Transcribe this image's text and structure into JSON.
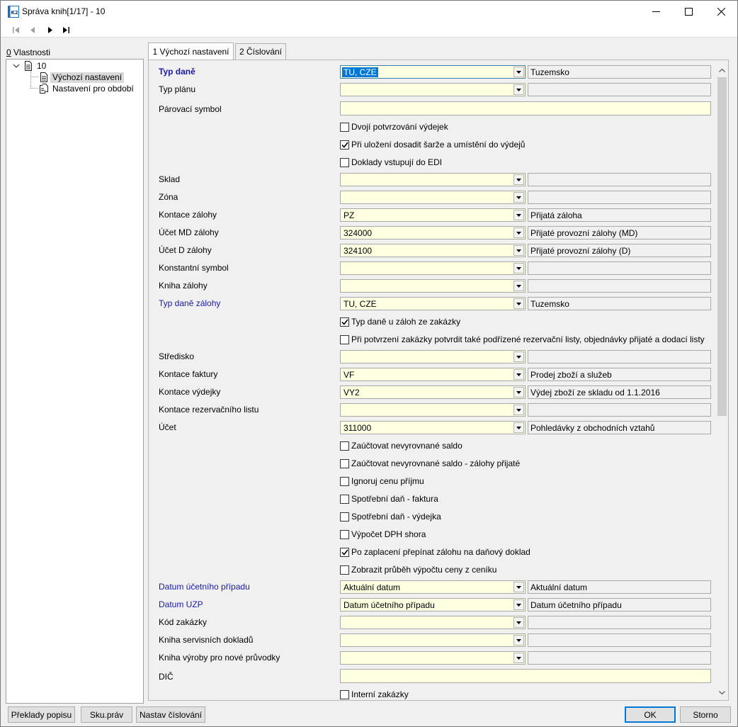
{
  "window": {
    "title": "Správa knih[1/17] - 10",
    "icon": "k2-app-icon"
  },
  "nav": {
    "buttons": [
      "first-record-icon",
      "previous-record-icon",
      "next-record-icon",
      "last-record-icon"
    ]
  },
  "left": {
    "label_hotkey": "0",
    "label_rest": " Vlastnosti",
    "tree": {
      "root": "10",
      "children": [
        "Výchozí nastavení",
        "Nastavení pro období"
      ]
    }
  },
  "tabs": [
    {
      "label": "1 Výchozí nastavení",
      "active": true
    },
    {
      "label": "2 Číslování",
      "active": false
    }
  ],
  "form": {
    "typ_dane": {
      "label": "Typ daně",
      "value": "TU, CZE",
      "desc": "Tuzemsko"
    },
    "typ_planu": {
      "label": "Typ plánu",
      "value": "",
      "desc": ""
    },
    "parovaci_symbol": {
      "label": "Párovací symbol",
      "value": ""
    },
    "dvoji_potvrzovani": {
      "label": "Dvojí potvrzování výdejek",
      "checked": false
    },
    "pri_ulozeni": {
      "label": "Při uložení dosadit šarže a umístění do výdejů",
      "checked": true
    },
    "doklady_edi": {
      "label": "Doklady vstupují do EDI",
      "checked": false
    },
    "sklad": {
      "label": "Sklad",
      "value": "",
      "desc": ""
    },
    "zona": {
      "label": "Zóna",
      "value": "",
      "desc": ""
    },
    "kontace_zalohy": {
      "label": "Kontace zálohy",
      "value": "PZ",
      "desc": "Přijatá záloha"
    },
    "ucet_md_zalohy": {
      "label": "Účet MD zálohy",
      "value": "324000",
      "desc": "Přijaté provozní zálohy (MD)"
    },
    "ucet_d_zalohy": {
      "label": "Účet D zálohy",
      "value": "324100",
      "desc": "Přijaté provozní zálohy (D)"
    },
    "konstantni_symbol": {
      "label": "Konstantní symbol",
      "value": "",
      "desc": ""
    },
    "kniha_zalohy": {
      "label": "Kniha zálohy",
      "value": "",
      "desc": ""
    },
    "typ_dane_zalohy": {
      "label": "Typ daně zálohy",
      "value": "TU, CZE",
      "desc": "Tuzemsko"
    },
    "typ_dane_u_zaloh": {
      "label": "Typ daně u záloh ze zakázky",
      "checked": true
    },
    "pri_potvrzeni": {
      "label": "Při potvrzení zakázky potvrdit také podřízené rezervační listy, objednávky přijaté a dodací listy",
      "checked": false
    },
    "stredisko": {
      "label": "Středisko",
      "value": "",
      "desc": ""
    },
    "kontace_faktury": {
      "label": "Kontace faktury",
      "value": "VF",
      "desc": "Prodej zboží a služeb"
    },
    "kontace_vydejky": {
      "label": "Kontace výdejky",
      "value": "VY2",
      "desc": "Výdej zboží ze skladu od 1.1.2016"
    },
    "kontace_rezervacniho": {
      "label": "Kontace rezervačního listu",
      "value": "",
      "desc": ""
    },
    "ucet": {
      "label": "Účet",
      "value": "311000",
      "desc": "Pohledávky z obchodních vztahů"
    },
    "zauctovat_saldo": {
      "label": "Zaúčtovat nevyrovnané saldo",
      "checked": false
    },
    "zauctovat_saldo_zalohy": {
      "label": "Zaúčtovat nevyrovnané saldo - zálohy přijaté",
      "checked": false
    },
    "ignoruj_cenu": {
      "label": "Ignoruj cenu příjmu",
      "checked": false
    },
    "spotrebni_faktura": {
      "label": "Spotřební daň - faktura",
      "checked": false
    },
    "spotrebni_vydejka": {
      "label": "Spotřební daň - výdejka",
      "checked": false
    },
    "vypocet_dph": {
      "label": "Výpočet DPH shora",
      "checked": false
    },
    "po_zaplaceni": {
      "label": "Po zaplacení přepínat zálohu na daňový doklad",
      "checked": true
    },
    "zobrazit_prubeh": {
      "label": "Zobrazit průběh výpočtu ceny z ceníku",
      "checked": false
    },
    "datum_ucetniho": {
      "label": "Datum účetního případu",
      "value": "Aktuální datum",
      "desc": "Aktuální datum"
    },
    "datum_uzp": {
      "label": "Datum UZP",
      "value": "Datum účetního případu",
      "desc": "Datum účetního případu"
    },
    "kod_zakazky": {
      "label": "Kód zakázky",
      "value": "",
      "desc": ""
    },
    "kniha_servisnich": {
      "label": "Kniha servisních dokladů",
      "value": "",
      "desc": ""
    },
    "kniha_vyroby": {
      "label": "Kniha výroby pro nové průvodky",
      "value": "",
      "desc": ""
    },
    "dic": {
      "label": "DIČ",
      "value": ""
    },
    "interni_zakazky": {
      "label": "Interní zakázky",
      "checked": false
    }
  },
  "buttons": {
    "preklady": "Překlady popisu",
    "sku_prav": "Sku.práv",
    "nastav_cislovani": "Nastav číslování",
    "ok": "OK",
    "storno": "Storno"
  }
}
